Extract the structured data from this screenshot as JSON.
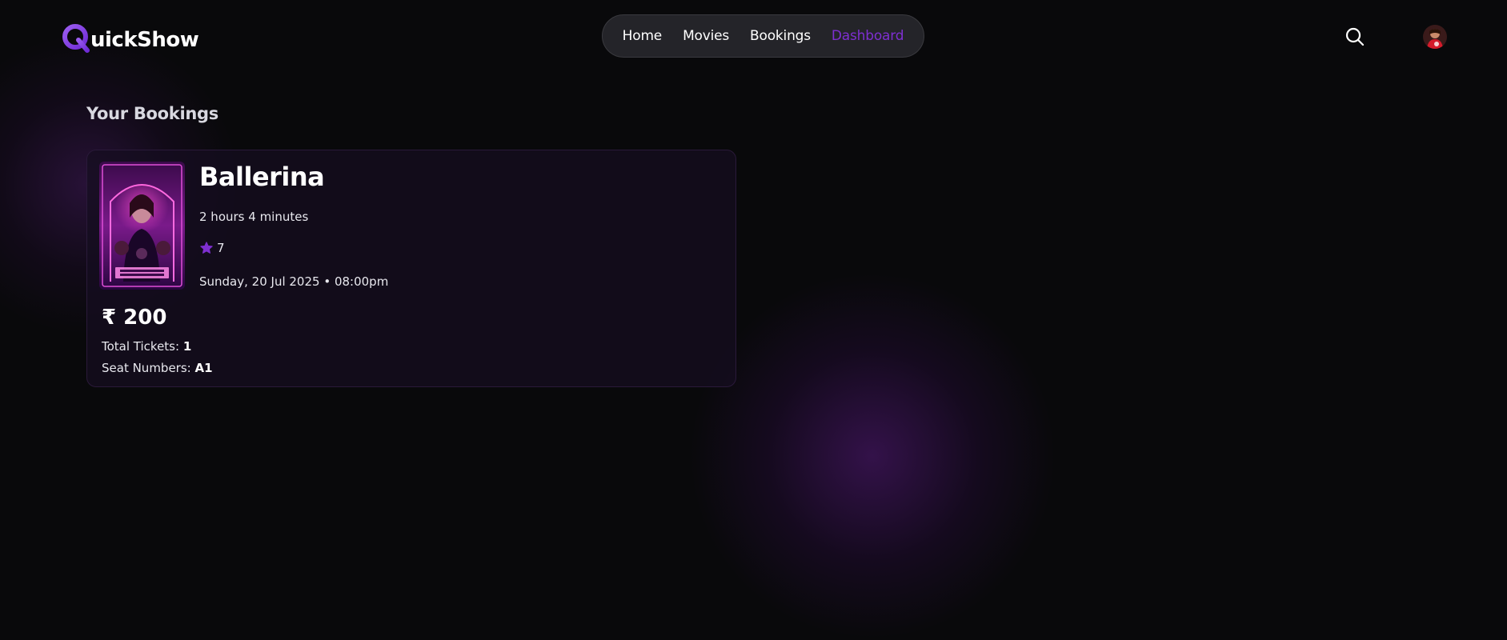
{
  "app": {
    "name": "QuickShow",
    "logo_letter": "Q",
    "logo_rest": "uickShow",
    "accent_color": "#7e2fd0"
  },
  "nav": {
    "items": [
      {
        "label": "Home",
        "active": false
      },
      {
        "label": "Movies",
        "active": false
      },
      {
        "label": "Bookings",
        "active": false
      },
      {
        "label": "Dashboard",
        "active": true
      }
    ]
  },
  "header": {
    "search_icon": "search-icon",
    "avatar_icon": "user-avatar"
  },
  "page": {
    "title": "Your Bookings"
  },
  "bookings": [
    {
      "title": "Ballerina",
      "duration": "2 hours 4 minutes",
      "rating": "7",
      "showtime": "Sunday, 20 Jul 2025 • 08:00pm",
      "price": "₹ 200",
      "total_tickets_label": "Total Tickets:",
      "total_tickets": "1",
      "seat_numbers_label": "Seat Numbers:",
      "seat_numbers": "A1",
      "poster_icon": "movie-poster-ballerina"
    }
  ]
}
